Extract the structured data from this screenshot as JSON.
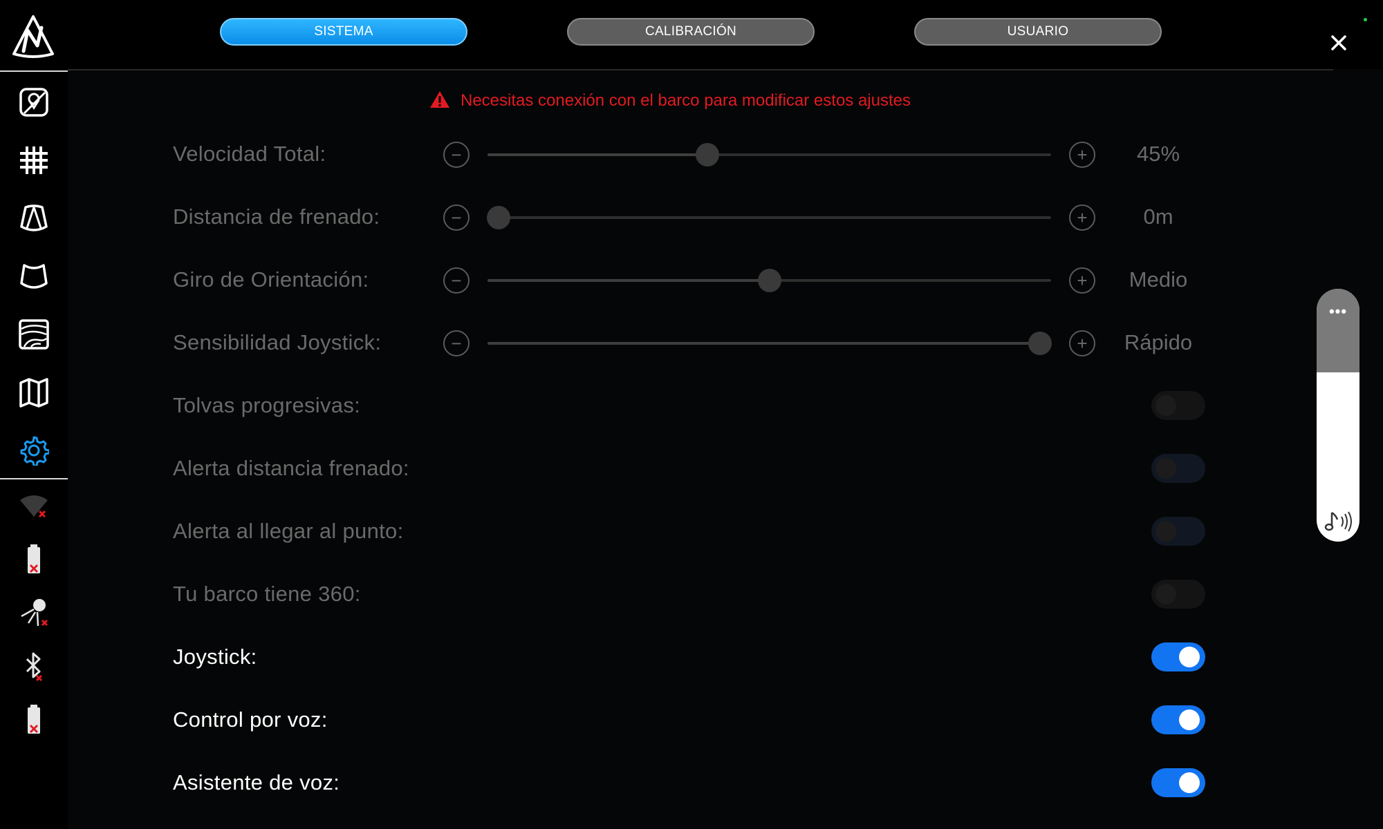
{
  "tabs": [
    {
      "label": "SISTEMA",
      "active": true
    },
    {
      "label": "CALIBRACIÓN",
      "active": false
    },
    {
      "label": "USUARIO",
      "active": false
    }
  ],
  "warning": {
    "icon": "warning-triangle-icon",
    "text": "Necesitas conexión con el barco para modificar estos ajustes",
    "color": "#e11b22"
  },
  "sidebar": {
    "logo": "navionics-n-logo",
    "nav": [
      {
        "name": "map-pin-icon",
        "active": false
      },
      {
        "name": "grid-icon",
        "active": false
      },
      {
        "name": "sonar-cone-icon",
        "active": false
      },
      {
        "name": "down-scan-icon",
        "active": false
      },
      {
        "name": "bathymetry-icon",
        "active": false
      },
      {
        "name": "map-icon",
        "active": false
      },
      {
        "name": "gear-icon",
        "active": true
      }
    ],
    "status": [
      {
        "name": "wifi-disconnected-icon"
      },
      {
        "name": "battery-disconnected-icon"
      },
      {
        "name": "satellite-disconnected-icon"
      },
      {
        "name": "bluetooth-disconnected-icon"
      },
      {
        "name": "battery-2-disconnected-icon"
      }
    ]
  },
  "sliders": [
    {
      "label": "Velocidad Total:",
      "value": "45%",
      "level": 0.39
    },
    {
      "label": "Distancia de frenado:",
      "value": "0m",
      "level": 0.02
    },
    {
      "label": "Giro de Orientación:",
      "value": "Medio",
      "level": 0.5
    },
    {
      "label": "Sensibilidad Joystick:",
      "value": "Rápido",
      "level": 0.98
    }
  ],
  "toggles": [
    {
      "label": "Tolvas progresivas:",
      "on": false,
      "enabled": false
    },
    {
      "label": "Alerta distancia frenado:",
      "on": false,
      "enabled": false
    },
    {
      "label": "Alerta al llegar al punto:",
      "on": false,
      "enabled": false
    },
    {
      "label": "Tu barco tiene 360:",
      "on": false,
      "enabled": false
    },
    {
      "label": "Joystick:",
      "on": true,
      "enabled": true
    },
    {
      "label": "Control por voz:",
      "on": true,
      "enabled": true
    },
    {
      "label": "Asistente de voz:",
      "on": true,
      "enabled": true
    }
  ],
  "volume": {
    "menu": "•••",
    "level": 0.67,
    "icon": "speaker-volume-icon"
  },
  "colors": {
    "accent": "#1274f0",
    "tab_active": "#1aa3f5",
    "warning": "#e11b22"
  }
}
